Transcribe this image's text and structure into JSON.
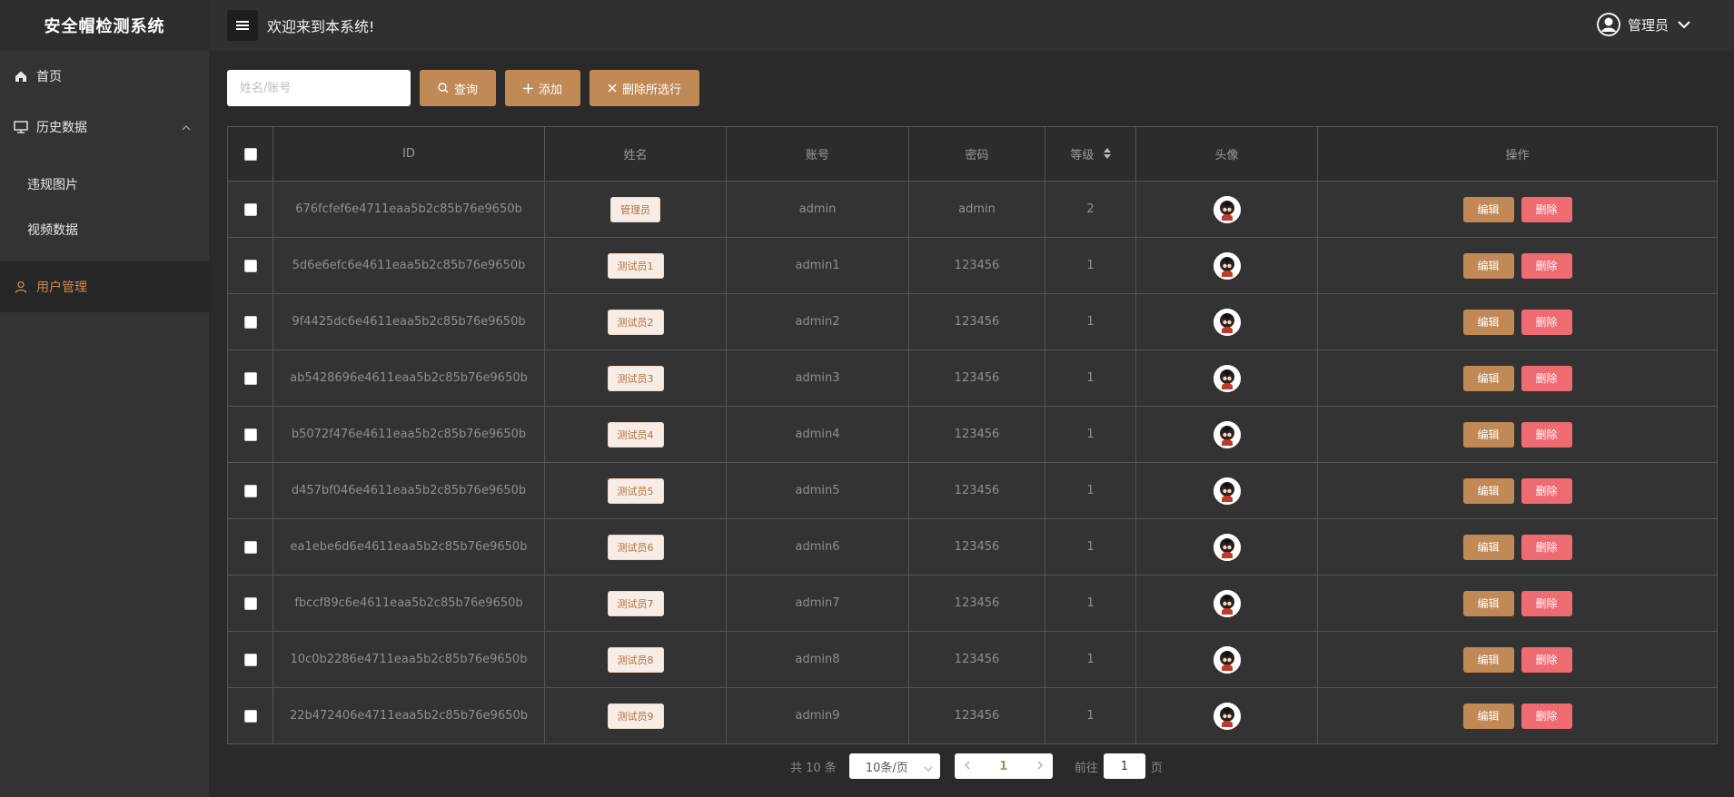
{
  "app": {
    "title": "安全帽检测系统"
  },
  "header": {
    "welcome": "欢迎来到本系统!",
    "user_name": "管理员"
  },
  "sidebar": {
    "items": [
      {
        "label": "首页",
        "icon": "home-icon"
      },
      {
        "label": "历史数据",
        "icon": "monitor-icon",
        "expanded": true,
        "children": [
          {
            "label": "违规图片"
          },
          {
            "label": "视频数据"
          }
        ]
      },
      {
        "label": "用户管理",
        "icon": "user-icon",
        "active": true
      }
    ]
  },
  "toolbar": {
    "search_placeholder": "姓名/账号",
    "query_label": "查询",
    "add_label": "添加",
    "delete_selected_label": "删除所选行"
  },
  "table": {
    "columns": [
      "ID",
      "姓名",
      "账号",
      "密码",
      "等级",
      "头像",
      "操作"
    ],
    "edit_label": "编辑",
    "delete_label": "删除",
    "rows": [
      {
        "id": "676fcfef6e4711eaa5b2c85b76e9650b",
        "name": "管理员",
        "account": "admin",
        "password": "admin",
        "level": "2"
      },
      {
        "id": "5d6e6efc6e4611eaa5b2c85b76e9650b",
        "name": "测试员1",
        "account": "admin1",
        "password": "123456",
        "level": "1"
      },
      {
        "id": "9f4425dc6e4611eaa5b2c85b76e9650b",
        "name": "测试员2",
        "account": "admin2",
        "password": "123456",
        "level": "1"
      },
      {
        "id": "ab5428696e4611eaa5b2c85b76e9650b",
        "name": "测试员3",
        "account": "admin3",
        "password": "123456",
        "level": "1"
      },
      {
        "id": "b5072f476e4611eaa5b2c85b76e9650b",
        "name": "测试员4",
        "account": "admin4",
        "password": "123456",
        "level": "1"
      },
      {
        "id": "d457bf046e4611eaa5b2c85b76e9650b",
        "name": "测试员5",
        "account": "admin5",
        "password": "123456",
        "level": "1"
      },
      {
        "id": "ea1ebe6d6e4611eaa5b2c85b76e9650b",
        "name": "测试员6",
        "account": "admin6",
        "password": "123456",
        "level": "1"
      },
      {
        "id": "fbccf89c6e4611eaa5b2c85b76e9650b",
        "name": "测试员7",
        "account": "admin7",
        "password": "123456",
        "level": "1"
      },
      {
        "id": "10c0b2286e4711eaa5b2c85b76e9650b",
        "name": "测试员8",
        "account": "admin8",
        "password": "123456",
        "level": "1"
      },
      {
        "id": "22b472406e4711eaa5b2c85b76e9650b",
        "name": "测试员9",
        "account": "admin9",
        "password": "123456",
        "level": "1"
      }
    ]
  },
  "pagination": {
    "total_text": "共 10 条",
    "page_size": "10条/页",
    "current_page": "1",
    "goto_prefix": "前往",
    "goto_value": "1",
    "goto_suffix": "页"
  },
  "colors": {
    "accent": "#c08956",
    "danger": "#ef6b72",
    "sidebar_bg": "#333333",
    "main_bg": "#2a2a2a"
  }
}
